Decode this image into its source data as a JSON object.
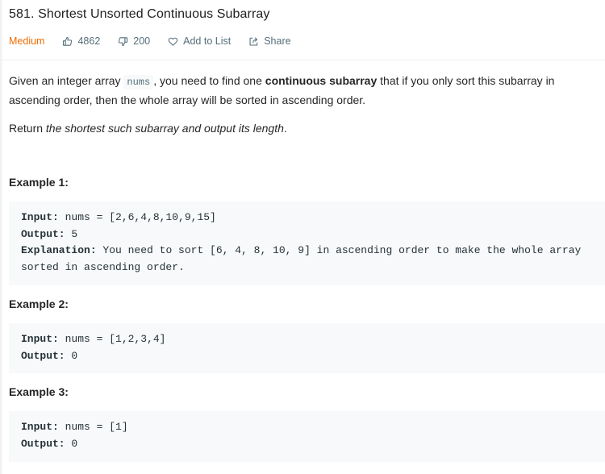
{
  "problem": {
    "title": "581. Shortest Unsorted Continuous Subarray",
    "difficulty": "Medium",
    "likes": "4862",
    "dislikes": "200",
    "add_to_list": "Add to List",
    "share": "Share"
  },
  "description": {
    "p1_part1": "Given an integer array ",
    "p1_code": "nums",
    "p1_part2": ", you need to find one ",
    "p1_bold": "continuous subarray",
    "p1_part3": " that if you only sort this subarray in ascending order, then the whole array will be sorted in ascending order.",
    "p2_part1": "Return ",
    "p2_italic": "the shortest such subarray and output its length",
    "p2_part2": "."
  },
  "examples": [
    {
      "title": "Example 1:",
      "input_label": "Input:",
      "input_value": " nums = [2,6,4,8,10,9,15]",
      "output_label": "Output:",
      "output_value": " 5",
      "explanation_label": "Explanation:",
      "explanation_value": " You need to sort [6, 4, 8, 10, 9] in ascending order to make the whole array sorted in ascending order."
    },
    {
      "title": "Example 2:",
      "input_label": "Input:",
      "input_value": " nums = [1,2,3,4]",
      "output_label": "Output:",
      "output_value": " 0"
    },
    {
      "title": "Example 3:",
      "input_label": "Input:",
      "input_value": " nums = [1]",
      "output_label": "Output:",
      "output_value": " 0"
    }
  ],
  "colors": {
    "difficulty_medium": "#ef6c00",
    "meta_text": "#546e7a",
    "code_background": "#f7f9fa"
  }
}
